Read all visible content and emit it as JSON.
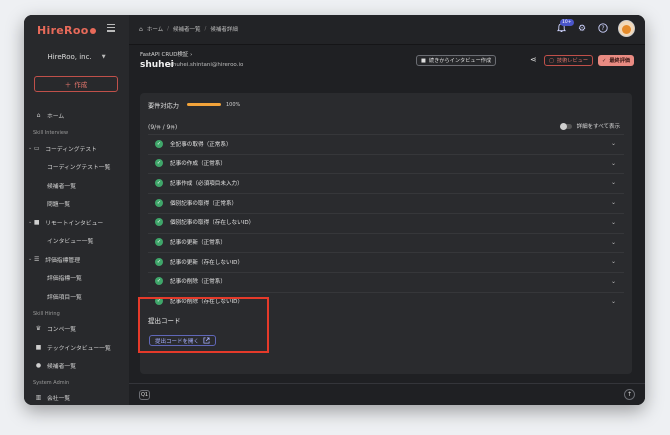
{
  "brand": {
    "logo_text": "HireRoo",
    "accent": "#e86a5a"
  },
  "sidebar": {
    "org_name": "HireRoo, inc.",
    "create_label": "作成",
    "home_label": "ホーム",
    "section_skill_interview": "Skill Interview",
    "coding_test": "コーディングテスト",
    "coding_test_list": "コーディングテスト一覧",
    "candidate_list": "候補者一覧",
    "problem_list": "問題一覧",
    "remote_interview": "リモートインタビュー",
    "interview_list": "インタビュー一覧",
    "eval_management": "評価指標管理",
    "eval_index_list": "評価指標一覧",
    "eval_item_list": "評価項目一覧",
    "section_skill_hiring": "Skill Hiring",
    "competition_list": "コンペ一覧",
    "tech_interview_list": "テックインタビュー一覧",
    "candidate_list_2": "候補者一覧",
    "section_system_admin": "System Admin",
    "company_list": "会社一覧"
  },
  "topbar": {
    "crumbs": [
      "ホーム",
      "候補者一覧",
      "候補者詳細"
    ],
    "notification_count": "10+"
  },
  "candidate": {
    "test_name": "FastAPI CRUD検証",
    "name": "shuhei",
    "email": "shuhei.shintani@hireroo.io"
  },
  "actions": {
    "continue_interview": "続きからインタビュー作成",
    "tech_review": "技術レビュー",
    "final_eval": "最終評価"
  },
  "requirements": {
    "label": "要件対応力",
    "percent_text": "100%",
    "progress": 1.0,
    "count_text": "(9/",
    "count_unit": "件",
    "count_total": "9",
    "show_all_label": "詳細をすべて表示",
    "items": [
      "全記事の取得（正常系）",
      "記事の作成（正常系）",
      "記事作成（必須項目未入力）",
      "個別記事の取得（正常系）",
      "個別記事の取得（存在しないID）",
      "記事の更新（正常系）",
      "記事の更新（存在しないID）",
      "記事の削除（正常系）",
      "記事の削除（存在しないID）"
    ]
  },
  "submission": {
    "title": "提出コード",
    "open_button": "提出コードを開く"
  },
  "footer": {
    "q_label": "Q1"
  }
}
